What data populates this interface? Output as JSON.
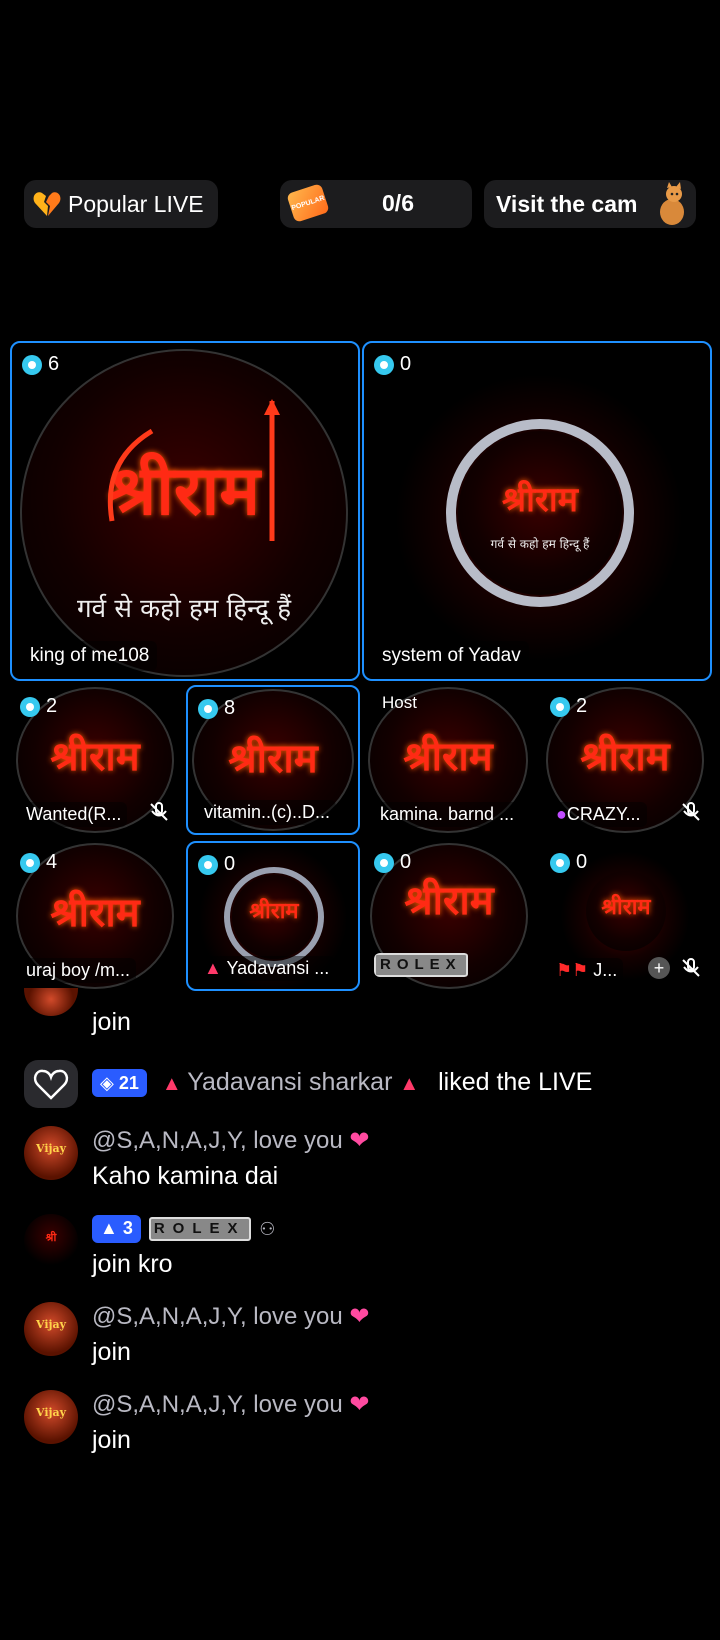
{
  "top": {
    "popular_label": "Popular LIVE",
    "quest_badge": "POPULAR",
    "quest_count": "0/6",
    "visit_label": "Visit the cam"
  },
  "big_tiles": [
    {
      "count": "6",
      "name": "king of me108",
      "logo": "श्रीराम",
      "tagline": "गर्व से कहो हम हिन्दू हैं"
    },
    {
      "count": "0",
      "name": "system of Yadav",
      "logo": "श्रीराम",
      "tagline": "गर्व से कहो हम हिन्दू हैं"
    }
  ],
  "row2": [
    {
      "count": "2",
      "name": "Wanted(R..."
    },
    {
      "count": "8",
      "name": "vitamin..(c)..D..."
    },
    {
      "host_label": "Host",
      "name": "kamina. barnd ..."
    },
    {
      "count": "2",
      "name": "CRAZY..."
    }
  ],
  "row3": [
    {
      "count": "4",
      "name": "uraj boy   /m..."
    },
    {
      "count": "0",
      "name": "Yadavansi ..."
    },
    {
      "count": "0",
      "name": "ROLEX"
    },
    {
      "count": "0",
      "name": "J..."
    }
  ],
  "chat": {
    "first_text": "join",
    "like_level": "21",
    "like_user": "Yadavansi sharkar",
    "like_text": "liked the LIVE",
    "messages": [
      {
        "user": "@S,A,N,A,J,Y,  love you",
        "text": "Kaho kamina dai"
      },
      {
        "level": "3",
        "user": "ROLEX",
        "text": "join kro"
      },
      {
        "user": "@S,A,N,A,J,Y,  love you",
        "text": "join"
      },
      {
        "user": "@S,A,N,A,J,Y,  love you",
        "text": "join"
      }
    ]
  },
  "colors": {
    "accent": "#1e90ff",
    "count_dot": "#36c9ef",
    "logo_red": "#ff2a14",
    "level_blue": "#2a5cff"
  }
}
